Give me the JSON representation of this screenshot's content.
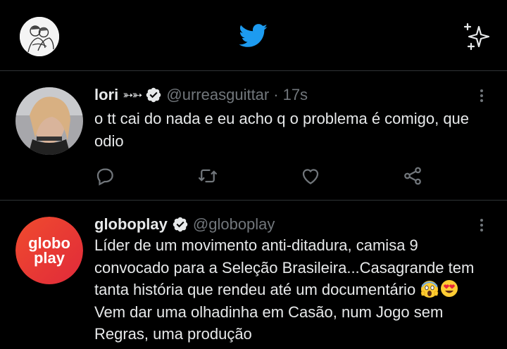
{
  "colors": {
    "background": "#000000",
    "border": "#2f3336",
    "text_primary": "#e7e9ea",
    "text_secondary": "#71767b",
    "brand_blue": "#1d9bf0",
    "globoplay_red": "#ef3b2d"
  },
  "header": {
    "avatar_icon": "profile-avatar",
    "logo_icon": "twitter-bird-icon",
    "right_icon": "sparkle-icon"
  },
  "tweets": [
    {
      "name": "lori",
      "name_suffix": "➳➳",
      "verified": true,
      "handle": "@urreasguittar",
      "separator": "·",
      "time": "17s",
      "text": "o tt cai do nada e eu acho q o problema é comigo, que odio",
      "actions": [
        "reply-icon",
        "retweet-icon",
        "like-icon",
        "share-icon"
      ]
    },
    {
      "name": "globoplay",
      "verified": true,
      "handle": "@globoplay",
      "avatar_text_line1": "globo",
      "avatar_text_line2": "play",
      "text_before_emoji": "Líder de um movimento anti-ditadura, camisa 9 convocado para a Seleção Brasileira...Casagrande tem tanta história que rendeu até um documentário ",
      "text_after_emoji": " Vem dar uma olhadinha em Casão, num Jogo sem Regras, uma produção",
      "emojis": [
        "screaming-face-emoji",
        "heart-eyes-emoji"
      ]
    }
  ]
}
